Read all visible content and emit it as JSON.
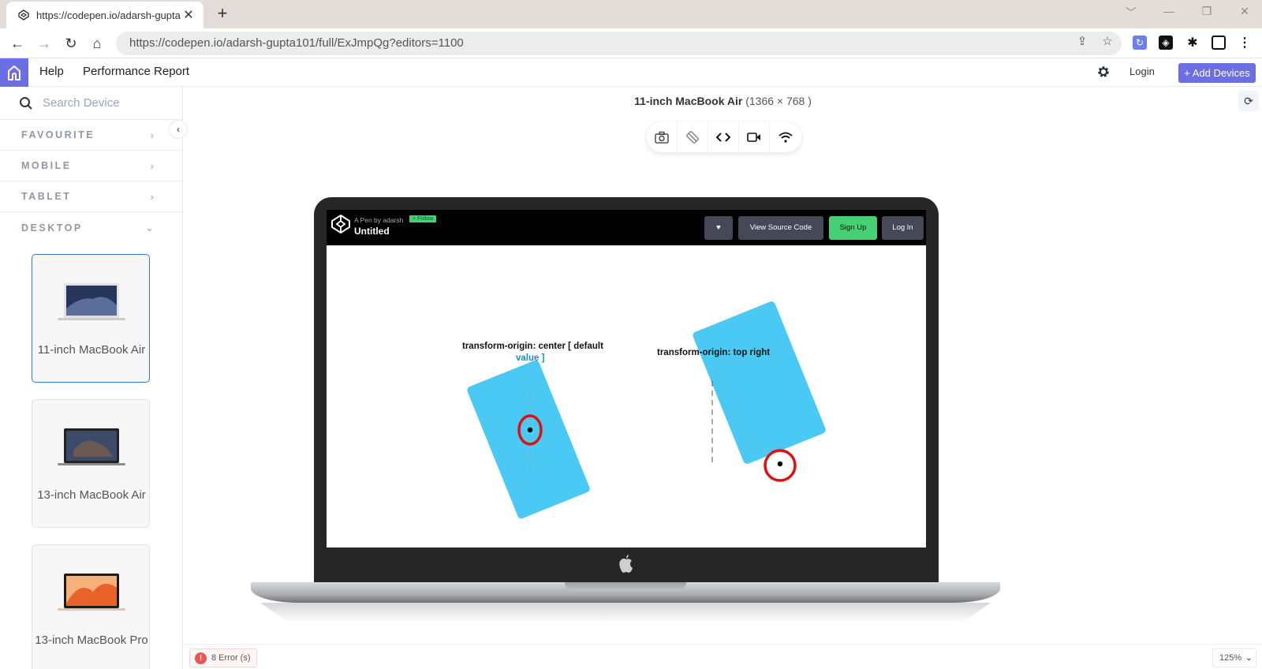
{
  "browser": {
    "tab_title": "https://codepen.io/adarsh-gupta",
    "tab_close": "✕",
    "new_tab": "+",
    "url": "https://codepen.io/adarsh-gupta101/full/ExJmpQg?editors=1100",
    "window_controls": [
      "﹀",
      "—",
      "❐",
      "✕"
    ]
  },
  "header": {
    "nav": [
      "Help",
      "Performance Report"
    ],
    "login": "Login",
    "add_devices": "+ Add Devices"
  },
  "sidebar": {
    "search_placeholder": "Search Device",
    "categories": [
      {
        "label": "FAVOURITE",
        "chevron": "›"
      },
      {
        "label": "MOBILE",
        "chevron": "›"
      },
      {
        "label": "TABLET",
        "chevron": "›"
      },
      {
        "label": "DESKTOP",
        "chevron": "⌄"
      }
    ],
    "devices": [
      {
        "name": "11-inch MacBook Air",
        "selected": true
      },
      {
        "name": "13-inch MacBook Air",
        "selected": false
      },
      {
        "name": "13-inch MacBook Pro",
        "selected": false
      }
    ]
  },
  "main": {
    "device_name": "11-inch MacBook Air",
    "device_resolution": "(1366 × 768 )",
    "toolbar": [
      "camera-icon",
      "rotate-icon",
      "code-icon",
      "video-icon",
      "wifi-icon"
    ]
  },
  "codepen": {
    "by": "A Pen by adarsh",
    "follow": "+ Follow",
    "title": "Untitled",
    "view_source": "View Source Code",
    "signup": "Sign Up",
    "login": "Log In",
    "demo_labels": {
      "left_line1": "transform-origin: center [ default",
      "left_line2": "value ]",
      "right": "transform-origin: top right"
    },
    "box_color": "#4ac9f5",
    "marker_color": "#e01010"
  },
  "footer": {
    "errors": "8 Error (s)",
    "zoom": "125%"
  }
}
